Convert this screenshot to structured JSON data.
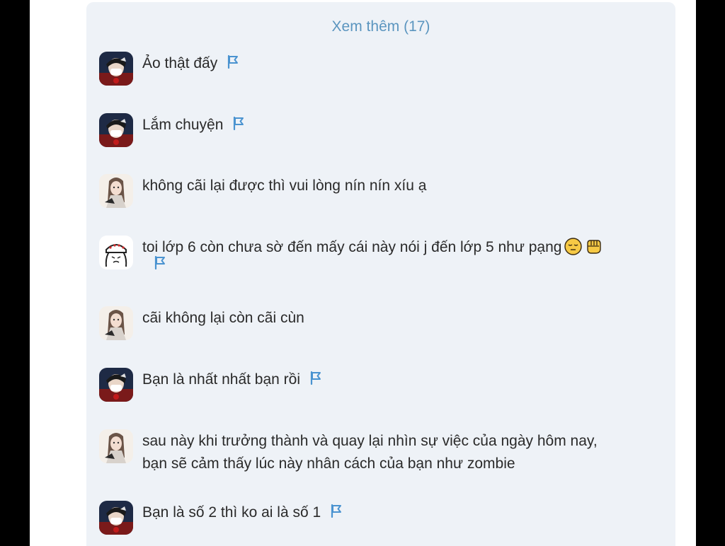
{
  "see_more_label": "Xem thêm (17)",
  "colors": {
    "panel_bg": "#eef2f7",
    "link": "#5b95bf",
    "text": "#2a2a2a",
    "flag": "#4a93d0"
  },
  "comments": [
    {
      "text": "Ảo thật đấy",
      "avatar": "user-avatar-a",
      "flag": true
    },
    {
      "text": "Lắm chuyện",
      "avatar": "user-avatar-a",
      "flag": true
    },
    {
      "text": "không cãi lại được thì vui lòng nín nín xíu ạ",
      "avatar": "user-avatar-b",
      "flag": false
    },
    {
      "text": "toi lớp 6 còn chưa sờ đến mấy cái này nói j đến lớp 5 như pạng",
      "avatar": "user-avatar-c",
      "flag": true,
      "emojis": [
        "pensive-face-emoji",
        "fist-emoji"
      ]
    },
    {
      "text": "cãi không lại còn cãi cùn",
      "avatar": "user-avatar-b",
      "flag": false
    },
    {
      "text": "Bạn là nhất nhất bạn rồi",
      "avatar": "user-avatar-a",
      "flag": true
    },
    {
      "text": "sau này khi trưởng thành và quay lại nhìn sự việc của ngày hôm nay,\nbạn sẽ cảm thấy lúc này nhân cách của bạn như zombie",
      "avatar": "user-avatar-b",
      "flag": false
    },
    {
      "text": "Bạn là số 2 thì ko ai là số 1",
      "avatar": "user-avatar-a",
      "flag": true
    }
  ]
}
